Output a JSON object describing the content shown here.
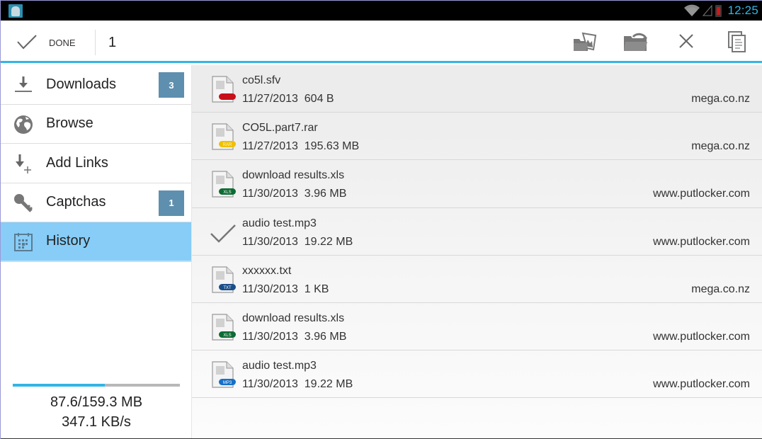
{
  "status_bar": {
    "clock": "12:25",
    "icons": [
      "app-notification-icon",
      "wifi-icon",
      "signal-icon",
      "battery-low-icon"
    ],
    "clock_color": "#33b5e5"
  },
  "action_bar": {
    "done_label": "DONE",
    "selected_count": "1",
    "actions": [
      {
        "name": "open-gallery-folder-icon"
      },
      {
        "name": "move-folder-icon"
      },
      {
        "name": "close-icon"
      },
      {
        "name": "copy-icon"
      }
    ],
    "accent_color": "#33b5e5"
  },
  "sidebar": {
    "items": [
      {
        "label": "Downloads",
        "badge": "3",
        "icon": "download-icon",
        "active": false
      },
      {
        "label": "Browse",
        "badge": null,
        "icon": "globe-icon",
        "active": false
      },
      {
        "label": "Add Links",
        "badge": null,
        "icon": "add-link-icon",
        "active": false
      },
      {
        "label": "Captchas",
        "badge": "1",
        "icon": "key-icon",
        "active": false
      },
      {
        "label": "History",
        "badge": null,
        "icon": "calendar-icon",
        "active": true
      }
    ],
    "progress_fraction": 0.55,
    "transfer_amount": "87.6/159.3 MB",
    "transfer_speed": "347.1 KB/s",
    "badge_color": "#5e8fae",
    "active_color": "#87cdf7"
  },
  "files": [
    {
      "name": "co5l.sfv",
      "date": "11/27/2013",
      "size": "604 B",
      "host": "mega.co.nz",
      "type": "sfv",
      "checked": false
    },
    {
      "name": "CO5L.part7.rar",
      "date": "11/27/2013",
      "size": "195.63 MB",
      "host": "mega.co.nz",
      "type": "RAR",
      "checked": false
    },
    {
      "name": "download results.xls",
      "date": "11/30/2013",
      "size": "3.96 MB",
      "host": "www.putlocker.com",
      "type": "XLS",
      "checked": false
    },
    {
      "name": "audio test.mp3",
      "date": "11/30/2013",
      "size": "19.22 MB",
      "host": "www.putlocker.com",
      "type": "MP3",
      "checked": true
    },
    {
      "name": "xxxxxx.txt",
      "date": "11/30/2013",
      "size": "1 KB",
      "host": "mega.co.nz",
      "type": "TXT",
      "checked": false
    },
    {
      "name": "download results.xls",
      "date": "11/30/2013",
      "size": "3.96 MB",
      "host": "www.putlocker.com",
      "type": "XLS",
      "checked": false
    },
    {
      "name": "audio test.mp3",
      "date": "11/30/2013",
      "size": "19.22 MB",
      "host": "www.putlocker.com",
      "type": "MP3",
      "checked": false
    }
  ]
}
